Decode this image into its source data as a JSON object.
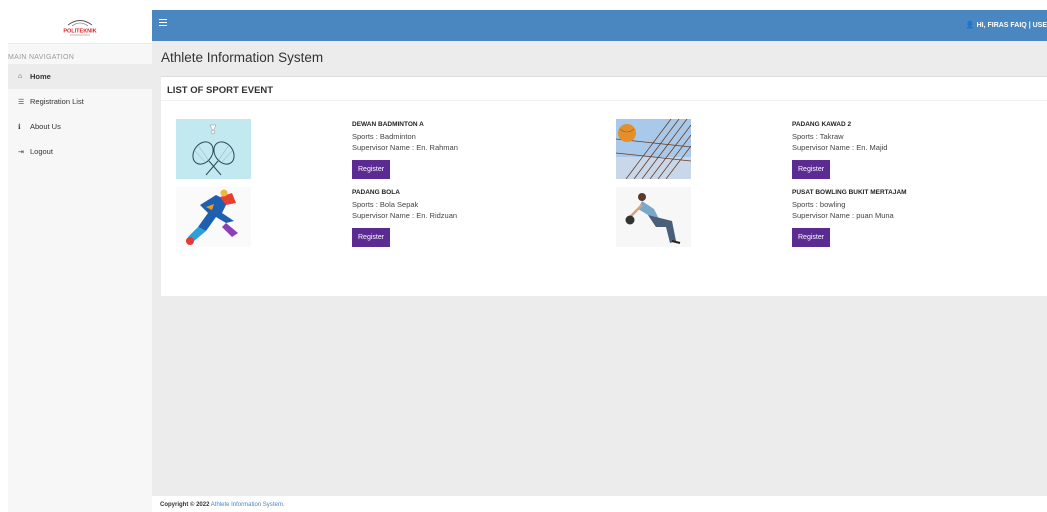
{
  "sidebar": {
    "logo_text": "POLITEKNIK",
    "nav_header": "MAIN NAVIGATION",
    "items": [
      {
        "icon": "home-icon",
        "glyph": "⌂",
        "label": "Home"
      },
      {
        "icon": "list-icon",
        "glyph": "☰",
        "label": "Registration List"
      },
      {
        "icon": "info-icon",
        "glyph": "ℹ",
        "label": "About Us"
      },
      {
        "icon": "logout-icon",
        "glyph": "⇥",
        "label": "Logout"
      }
    ]
  },
  "topbar": {
    "user_label": "HI, FIRAS FAIQ | USE"
  },
  "main": {
    "page_title": "Athlete Information System",
    "card_title": "LIST OF SPORT EVENT",
    "register_label": "Register",
    "events": [
      {
        "name": "DEWAN BADMINTON A",
        "sports": "Sports : Badminton",
        "supervisor": "Supervisor Name : En. Rahman",
        "image": "badminton-rackets-image"
      },
      {
        "name": "PADANG KAWAD 2",
        "sports": "Sports : Takraw",
        "supervisor": "Supervisor Name : En. Majid",
        "image": "takraw-net-ball-image"
      },
      {
        "name": "PADANG BOLA",
        "sports": "Sports : Bola Sepak",
        "supervisor": "Supervisor Name : En. Ridzuan",
        "image": "football-player-image"
      },
      {
        "name": "PUSAT BOWLING BUKIT MERTAJAM",
        "sports": "Sports : bowling",
        "supervisor": "Supervisor Name : puan Muna",
        "image": "bowler-image"
      }
    ]
  },
  "footer": {
    "prefix": "Copyright © 2022",
    "link": "Athlete Information System."
  },
  "colors": {
    "topbar": "#4a86bf",
    "button": "#5b2a92",
    "content_bg": "#ececec"
  }
}
